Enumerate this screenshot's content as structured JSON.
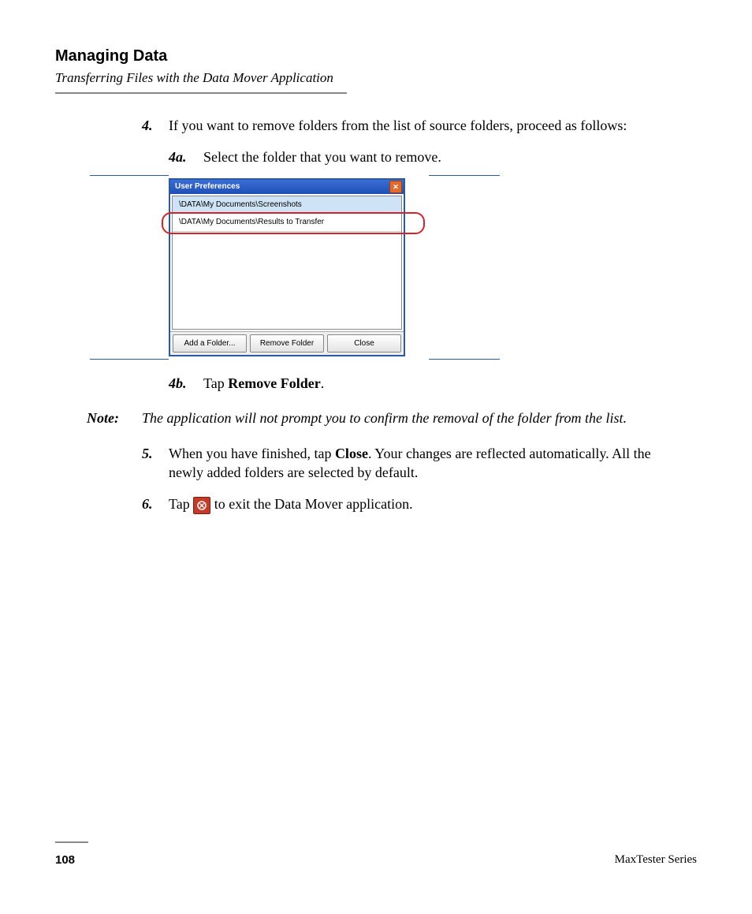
{
  "header": {
    "section": "Managing Data",
    "subsection": "Transferring Files with the Data Mover Application"
  },
  "steps": {
    "s4": {
      "num": "4.",
      "text": "If you want to remove folders from the list of source folders, proceed as follows:"
    },
    "s4a": {
      "num": "4a.",
      "text": "Select the folder that you want to remove."
    },
    "s4b": {
      "num": "4b.",
      "prefix": "Tap ",
      "bold": "Remove Folder",
      "suffix": "."
    },
    "s5": {
      "num": "5.",
      "prefix": "When you have finished, tap ",
      "bold": "Close",
      "suffix": ". Your changes are reflected automatically. All the newly added folders are selected by default."
    },
    "s6": {
      "num": "6.",
      "prefix": "Tap ",
      "suffix": " to exit the Data Mover application."
    }
  },
  "note": {
    "label": "Note:",
    "text": "The application will not prompt you to confirm the removal of the folder from the list."
  },
  "window": {
    "title": "User Preferences",
    "rows": [
      "\\DATA\\My Documents\\Screenshots",
      "\\DATA\\My Documents\\Results to Transfer"
    ],
    "buttons": {
      "add": "Add a Folder...",
      "remove": "Remove Folder",
      "close": "Close"
    }
  },
  "footer": {
    "page": "108",
    "series": "MaxTester Series"
  }
}
